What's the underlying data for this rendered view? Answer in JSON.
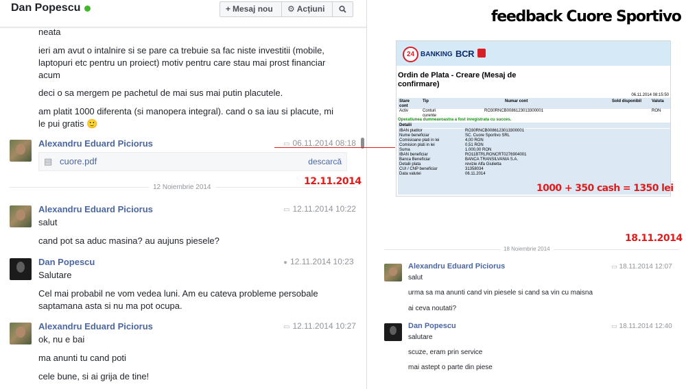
{
  "chat_left": {
    "header": {
      "name": "Dan Popescu",
      "new_message_label": "Mesaj nou",
      "actions_label": "Acțiuni"
    },
    "top_messages": [
      "neata",
      "ieri am avut o intalnire si se pare ca trebuie sa fac niste investitii (mobile, laptopuri etc pentru un proiect) motiv pentru care stau mai prost financiar acum",
      "deci o sa mergem pe pachetul de mai sus mai putin placutele.",
      "am platit 1000 diferenta (si manopera integral). cand o sa iau si placute, mi le pui gratis 🙂"
    ],
    "attach_block": {
      "sender": "Alexandru Eduard Piciorus",
      "timestamp": "06.11.2014 08:18",
      "file_name": "cuore.pdf",
      "download_label": "descarcă"
    },
    "day_separator": "12 Noiembrie 2014",
    "red_date": "12.11.2014",
    "blocks": [
      {
        "sender": "Alexandru Eduard Piciorus",
        "timestamp": "12.11.2014 10:22",
        "messages": [
          "salut",
          "cand pot sa aduc masina? au aujuns piesele?"
        ]
      },
      {
        "sender": "Dan Popescu",
        "timestamp": "12.11.2014 10:23",
        "messages": [
          "Salutare",
          "Cel mai probabil ne vom vedea luni. Am eu cateva probleme persobale saptamana asta si nu ma pot ocupa."
        ]
      },
      {
        "sender": "Alexandru Eduard Piciorus",
        "timestamp": "12.11.2014 10:27",
        "messages": [
          "ok, nu e bai",
          "ma anunti tu cand poti",
          "cele bune, si ai grija de tine!"
        ]
      }
    ]
  },
  "title": "feedback Cuore Sportivo",
  "bank_doc": {
    "badge": "24",
    "banking_label": "BANKING",
    "bank_name": "BCR",
    "title": "Ordin de Plata - Creare (Mesaj de confirmare)",
    "datetime": "06.11.2014 08:15:50",
    "columns": [
      "Stare cont",
      "Tip",
      "Numar cont",
      "Sold disponibil",
      "Valuta"
    ],
    "row": [
      "Activ",
      "Conturi curente",
      "RO30RNCB0086123013300001",
      "",
      "RON"
    ],
    "success_msg": "Operatiunea dumneavoastra a fost inregistrata cu succes.",
    "details_title": "Detalii",
    "details": [
      [
        "IBAN platitor",
        "RO30RNCB0086123013300001"
      ],
      [
        "Nume beneficiar",
        "SC. Cuore Sportivo SRL"
      ],
      [
        "Comisioane plati in lei",
        "4,00  RON"
      ],
      [
        "Comision plati in lei",
        "0,51  RON"
      ],
      [
        "Suma",
        "1.000,00  RON"
      ],
      [
        "IBAN beneficiar",
        "RO11BTRLRONCRT0276904001"
      ],
      [
        "Banca Beneficiar",
        "BANCA TRANSILVANIA S.A."
      ],
      [
        "Detalii plata",
        "revizie Alfa Giulietta"
      ],
      [
        "CUI / CNP beneficiar",
        "31358034"
      ],
      [
        "Data valutei",
        "06.11.2014"
      ]
    ]
  },
  "cash_note": "1000 + 350 cash = 1350 lei",
  "chat_right": {
    "red_date": "18.11.2014",
    "day_separator": "18 Noiembrie 2014",
    "blocks": [
      {
        "sender": "Alexandru Eduard Piciorus",
        "timestamp": "18.11.2014 12:07",
        "messages": [
          "salut",
          "urma sa ma anunti cand vin piesele si cand sa vin cu maisna",
          "ai ceva noutati?"
        ]
      },
      {
        "sender": "Dan Popescu",
        "timestamp": "18.11.2014 12:40",
        "messages": [
          "salutare",
          "scuze, eram prin service",
          "mai astept o parte din piese"
        ]
      }
    ]
  },
  "colors": {
    "sender_link": "#4b66a0",
    "annotation_red": "#e01b1b",
    "online_green": "#42b72a",
    "bank_header": "#d6e9f7",
    "success_green": "#178a17"
  }
}
